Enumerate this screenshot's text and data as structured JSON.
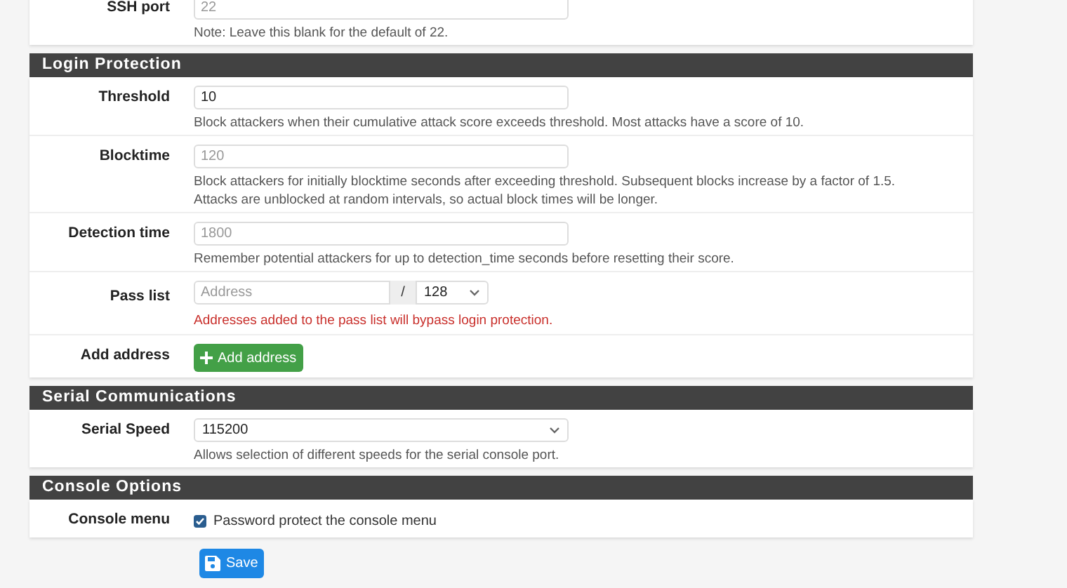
{
  "sections": [
    {
      "rows": [
        {
          "kind": "text",
          "label": "SSH port",
          "field": {
            "placeholder": "22"
          },
          "help": [
            "Note: Leave this blank for the default of 22."
          ]
        }
      ]
    },
    {
      "title": "Login Protection",
      "rows": [
        {
          "kind": "text",
          "label": "Threshold",
          "field": {
            "value": "10"
          },
          "help": [
            "Block attackers when their cumulative attack score exceeds threshold. Most attacks have a score of 10."
          ]
        },
        {
          "kind": "text",
          "label": "Blocktime",
          "field": {
            "placeholder": "120"
          },
          "help": [
            "Block attackers for initially blocktime seconds after exceeding threshold. Subsequent blocks increase by a factor of 1.5.",
            "Attacks are unblocked at random intervals, so actual block times will be longer."
          ]
        },
        {
          "kind": "text",
          "label": "Detection time",
          "field": {
            "placeholder": "1800"
          },
          "help": [
            "Remember potential attackers for up to detection_time seconds before resetting their score."
          ]
        },
        {
          "kind": "passlist",
          "label": "Pass list",
          "field": {
            "placeholder": "Address"
          },
          "separator": "/",
          "mask": "128",
          "warning": "Addresses added to the pass list will bypass login protection."
        },
        {
          "kind": "button",
          "label": "Add address",
          "button": "Add address"
        }
      ]
    },
    {
      "title": "Serial Communications",
      "rows": [
        {
          "kind": "select",
          "label": "Serial Speed",
          "value": "115200",
          "help": [
            "Allows selection of different speeds for the serial console port."
          ]
        }
      ]
    },
    {
      "title": "Console Options",
      "rows": [
        {
          "kind": "checkbox",
          "label": "Console menu",
          "checked": true,
          "text": "Password protect the console menu"
        }
      ]
    }
  ],
  "save": "Save"
}
